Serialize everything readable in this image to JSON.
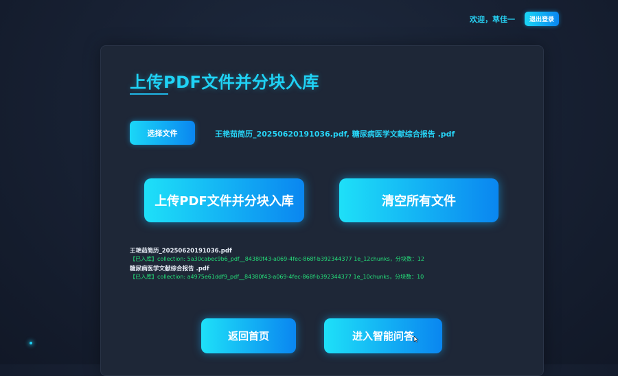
{
  "header": {
    "welcome_text": "欢迎，萃佳一",
    "logout_label": "退出登录"
  },
  "upload_panel": {
    "title": "上传PDF文件并分块入库",
    "choose_file_label": "选择文件",
    "selected_files": "王艳茹简历_20250620191036.pdf, 糖尿病医学文献综合报告 .pdf",
    "upload_button_label": "上传PDF文件并分块入库",
    "clear_button_label": "清空所有文件",
    "files": [
      {
        "name": "王艳茹简历_20250620191036.pdf",
        "status": "【已入库】collection: 5a30cabec9b6_pdf__84380f43-a069-4fec-868f-b392344377 1e_12chunks，分块数：12"
      },
      {
        "name": "糖尿病医学文献综合报告 .pdf",
        "status": "【已入库】collection: a4975e61ddf9_pdf__84380f43-a069-4fec-868f-b392344377 1e_10chunks，分块数：10"
      }
    ]
  },
  "footer_nav": {
    "home_label": "返回首页",
    "qa_label": "进入智能问答"
  },
  "colors": {
    "accent": "#1fd2f5",
    "button_gradient_start": "#1ee0f8",
    "button_gradient_end": "#0a86f0",
    "status_green": "#25e07a",
    "card_bg": "#1e2737",
    "page_bg": "#172032"
  },
  "icons": {
    "cursor": "mouse-pointer-icon"
  }
}
